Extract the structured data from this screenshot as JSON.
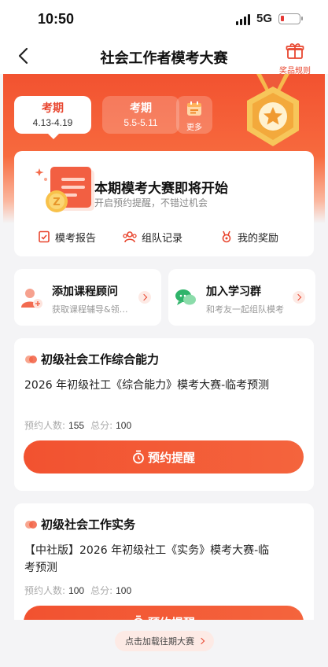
{
  "status_bar": {
    "time": "10:50",
    "network": "5G",
    "battery_level": 0.15,
    "battery_color": "#e53935"
  },
  "nav": {
    "title": "社会工作者模考大赛",
    "rules_label": "奖品规则"
  },
  "periods": [
    {
      "name": "考期",
      "dates": "4.13-4.19",
      "active": true
    },
    {
      "name": "考期",
      "dates": "5.5-5.11",
      "active": false
    }
  ],
  "more_label": "更多",
  "notice": {
    "title": "本期模考大赛即将开始",
    "subtitle": "开启预约提醒，不错过机会",
    "actions": [
      {
        "label": "模考报告",
        "icon": "report-icon"
      },
      {
        "label": "组队记录",
        "icon": "team-icon"
      },
      {
        "label": "我的奖励",
        "icon": "reward-icon"
      }
    ]
  },
  "mini_cards": [
    {
      "title": "添加课程顾问",
      "subtitle": "获取课程辅导&领…",
      "icon": "advisor-icon"
    },
    {
      "title": "加入学习群",
      "subtitle": "和考友一起组队模考",
      "icon": "chat-group-icon"
    }
  ],
  "exams": [
    {
      "title": "初级社会工作综合能力",
      "description": "2026 年初级社工《综合能力》模考大赛-临考预测",
      "reserve_label": "预约人数:",
      "reserve_count": "155",
      "score_label": "总分:",
      "score": "100",
      "button_label": "预约提醒"
    },
    {
      "title": "初级社会工作实务",
      "description": "【中社版】2026 年初级社工《实务》模考大赛-临考预测",
      "reserve_label": "预约人数:",
      "reserve_count": "100",
      "score_label": "总分:",
      "score": "100",
      "button_label": "预约提醒"
    }
  ],
  "footer": {
    "load_more_label": "点击加载往期大赛"
  },
  "colors": {
    "accent": "#e8462f",
    "hero_top": "#f25230",
    "page_bg": "#f4f4f6"
  }
}
